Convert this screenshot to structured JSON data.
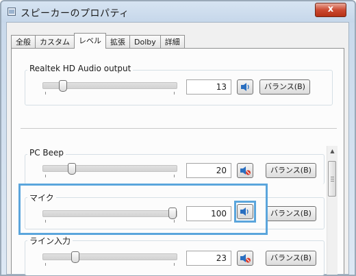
{
  "window": {
    "title": "スピーカーのプロパティ",
    "close_label": "x"
  },
  "tabs": [
    {
      "label": "全般",
      "active": false
    },
    {
      "label": "カスタム",
      "active": false
    },
    {
      "label": "レベル",
      "active": true
    },
    {
      "label": "拡張",
      "active": false
    },
    {
      "label": "Dolby",
      "active": false
    },
    {
      "label": "詳細",
      "active": false
    }
  ],
  "master": {
    "label": "Realtek HD Audio output",
    "value": "13",
    "level": 13,
    "balance_label": "バランス(B)",
    "muted": false
  },
  "channels": [
    {
      "label": "PC Beep",
      "value": "20",
      "level": 20,
      "balance_label": "バランス(B)",
      "muted": true
    },
    {
      "label": "マイク",
      "value": "100",
      "level": 100,
      "balance_label": "バランス(B)",
      "muted": false
    },
    {
      "label": "ライン入力",
      "value": "23",
      "level": 23,
      "balance_label": "バランス(B)",
      "muted": true
    }
  ],
  "colors": {
    "highlight": "#5aa5dc",
    "speaker_icon": "#2a6fc0",
    "mute_mark": "#d83a2a"
  },
  "icons": {
    "speaker": "speaker-icon",
    "muted_speaker": "speaker-muted-icon",
    "window": "app-icon"
  }
}
